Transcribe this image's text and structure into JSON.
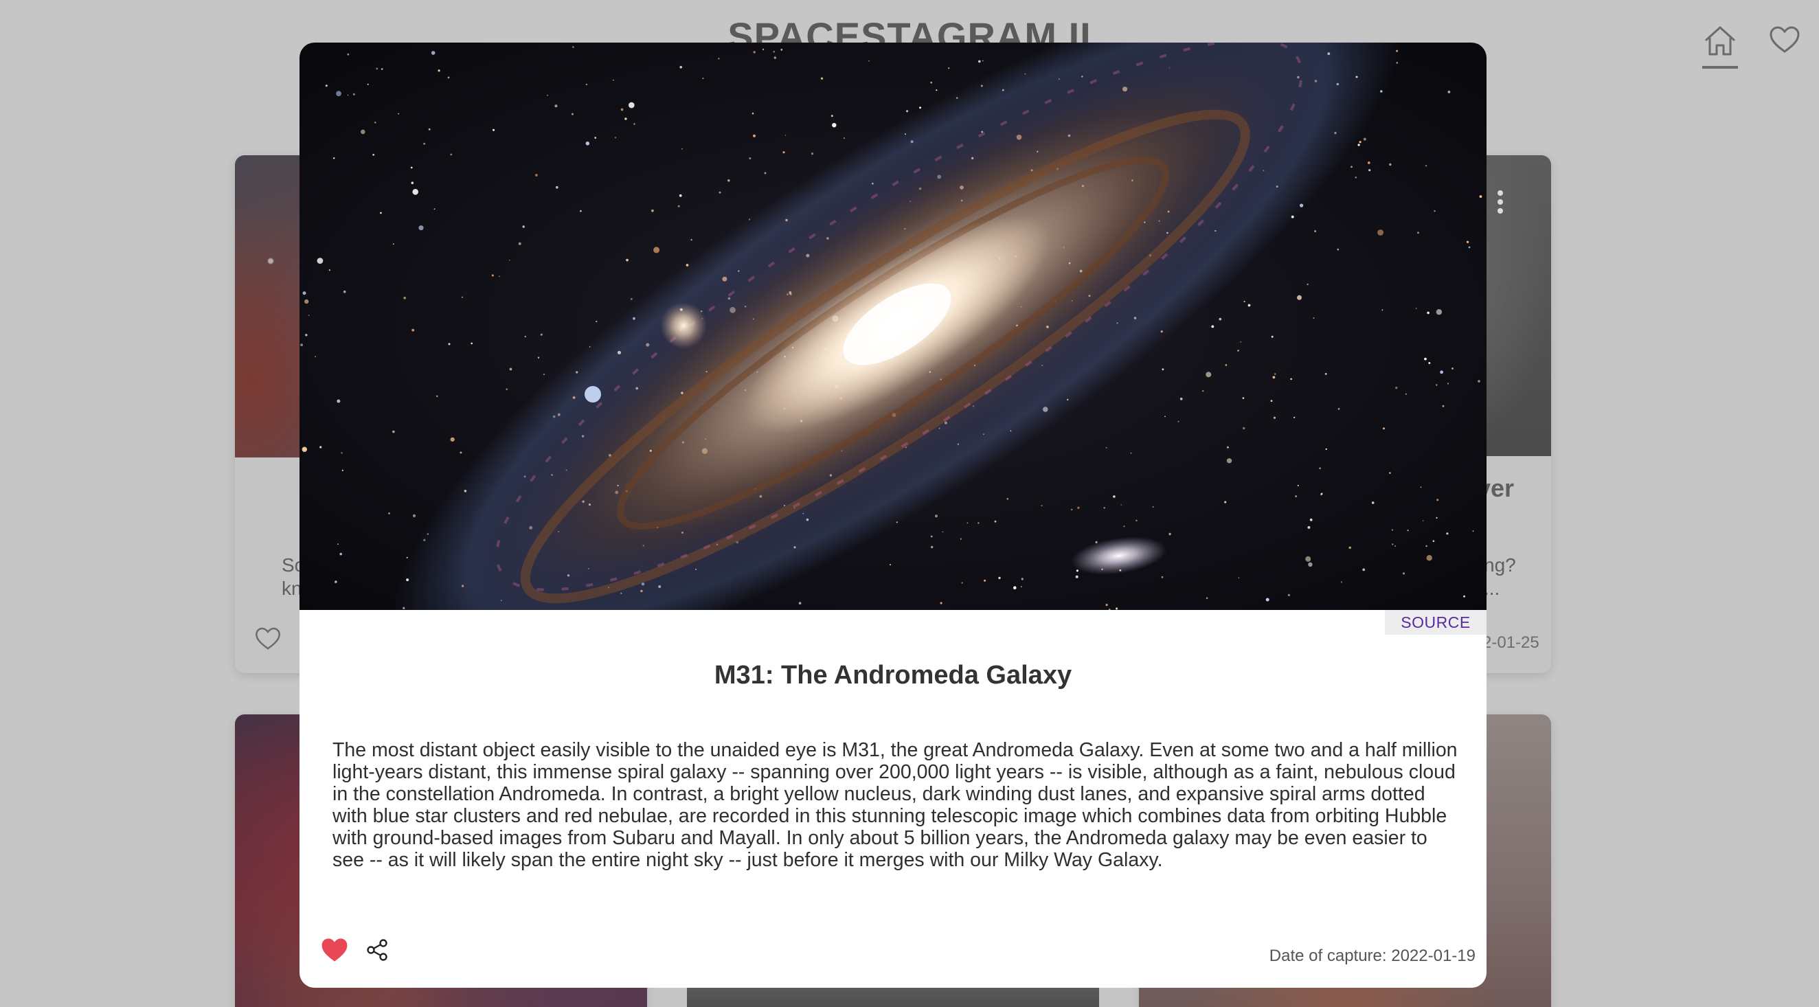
{
  "header": {
    "title": "SPACESTAGRAM II",
    "nav": {
      "home_icon": "home-icon",
      "likes_icon": "heart-outline-icon"
    }
  },
  "background_cards": {
    "left_top": {
      "text_line1": "Sc",
      "text_line2": "kn",
      "heart_icon": "heart-outline-icon"
    },
    "right_top": {
      "heading_fragment": "ver",
      "text_line1": "ng?",
      "text_line2": "...",
      "date_fragment": "2-01-25",
      "menu_icon": "kebab-menu-icon"
    }
  },
  "modal": {
    "image_alt": "M31: The Andromeda Galaxy",
    "source_label": "SOURCE",
    "title": "M31: The Andromeda Galaxy",
    "description": "The most distant object easily visible to the unaided eye is M31, the great Andromeda Galaxy. Even at some two and a half million light-years distant, this immense spiral galaxy -- spanning over 200,000 light years -- is visible, although as a faint, nebulous cloud in the constellation Andromeda. In contrast, a bright yellow nucleus, dark winding dust lanes, and expansive spiral arms dotted with blue star clusters and red nebulae, are recorded in this stunning telescopic image which combines data from orbiting Hubble with ground-based images from Subaru and Mayall. In only about 5 billion years, the Andromeda galaxy may be even easier to see -- as it will likely span the entire night sky -- just before it merges with our Milky Way Galaxy.",
    "capture_date": "Date of capture: 2022-01-19",
    "liked": true,
    "like_icon": "heart-filled-icon",
    "share_icon": "share-icon"
  },
  "colors": {
    "like_red": "#e84855",
    "source_purple": "#5a2aa0",
    "overlay_grey": "#c6c6c6"
  }
}
